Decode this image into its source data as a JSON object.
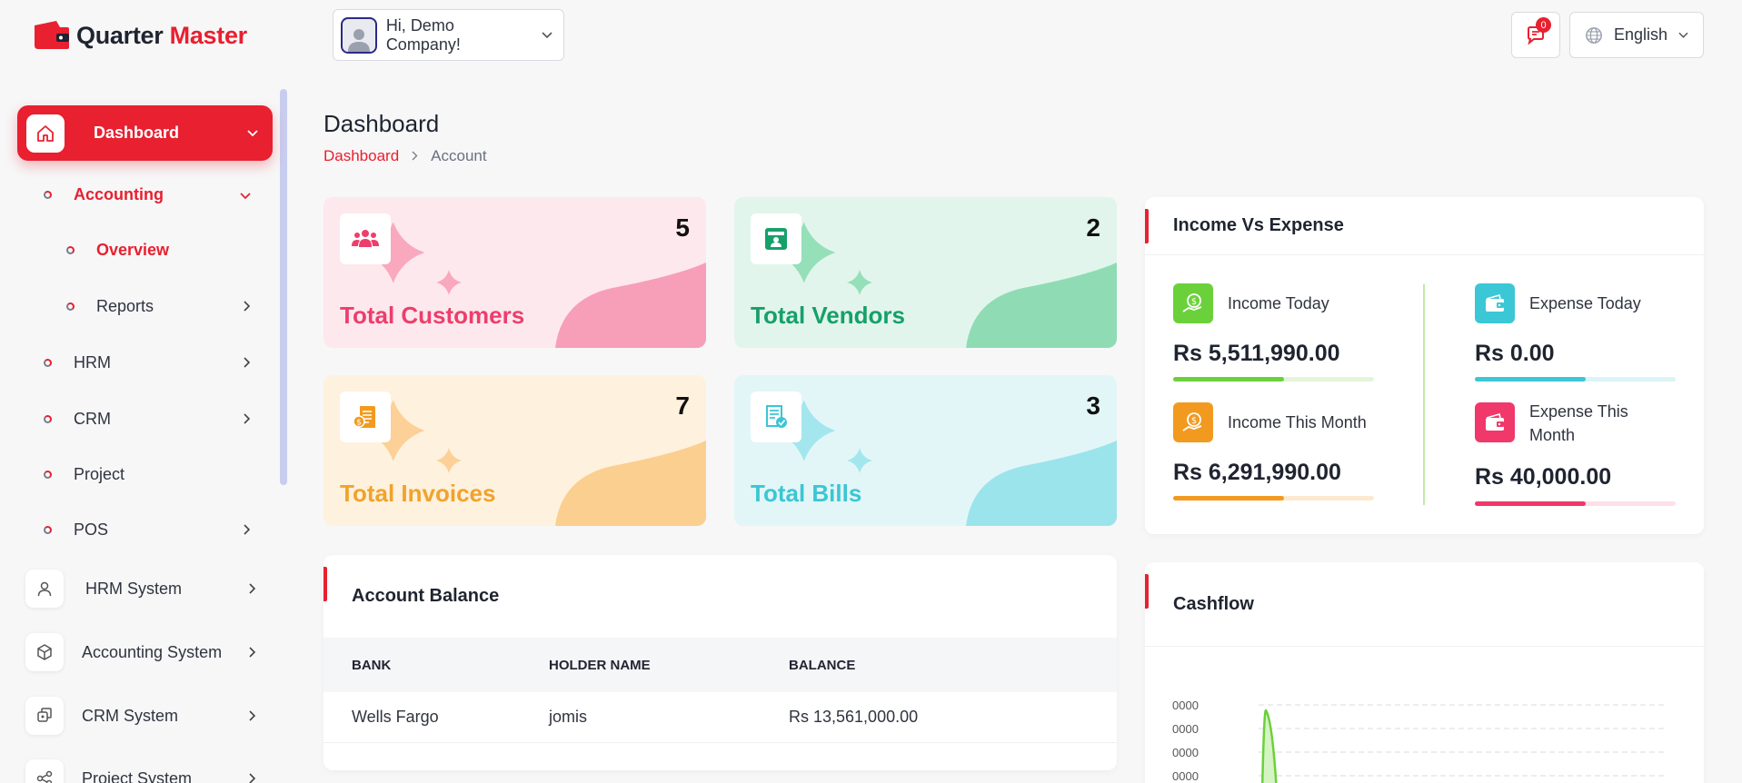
{
  "brand": {
    "name_part1": "Quarter",
    "name_part2": "Master"
  },
  "header": {
    "greeting": "Hi, Demo Company!",
    "notification_count": "0",
    "language": "English"
  },
  "sidebar": {
    "dashboard": "Dashboard",
    "accounting": "Accounting",
    "overview": "Overview",
    "reports": "Reports",
    "hrm": "HRM",
    "crm": "CRM",
    "project": "Project",
    "pos": "POS",
    "hrm_system": "HRM System",
    "accounting_system": "Accounting System",
    "crm_system": "CRM System",
    "project_system": "Project System"
  },
  "page": {
    "title": "Dashboard",
    "breadcrumb": {
      "home": "Dashboard",
      "current": "Account"
    }
  },
  "stats": {
    "customers": {
      "label": "Total Customers",
      "value": "5"
    },
    "vendors": {
      "label": "Total Vendors",
      "value": "2"
    },
    "invoices": {
      "label": "Total Invoices",
      "value": "7"
    },
    "bills": {
      "label": "Total Bills",
      "value": "3"
    }
  },
  "income_expense": {
    "title": "Income Vs Expense",
    "income_today": {
      "label": "Income Today",
      "amount": "Rs 5,511,990.00",
      "progress": 0.55
    },
    "income_month": {
      "label": "Income This Month",
      "amount": "Rs 6,291,990.00",
      "progress": 0.55
    },
    "expense_today": {
      "label": "Expense Today",
      "amount": "Rs 0.00",
      "progress": 0.55
    },
    "expense_month": {
      "label": "Expense This Month",
      "amount": "Rs 40,000.00",
      "progress": 0.55
    }
  },
  "account_balance": {
    "title": "Account Balance",
    "columns": [
      "BANK",
      "HOLDER NAME",
      "BALANCE"
    ],
    "rows": [
      {
        "bank": "Wells Fargo",
        "holder": "jomis",
        "balance": "Rs 13,561,000.00"
      }
    ]
  },
  "cashflow": {
    "title": "Cashflow",
    "tick_labels": [
      "0000",
      "0000",
      "0000",
      "0000"
    ]
  },
  "colors": {
    "brand": "#e8202f",
    "customers": "#ed3e6b",
    "vendors": "#16a06a",
    "invoices": "#f0a32c",
    "bills": "#3cc6d3",
    "income": "#6bd13b",
    "income_month": "#f29a1f",
    "expense": "#3bc7d6",
    "expense_month": "#f0386b"
  }
}
